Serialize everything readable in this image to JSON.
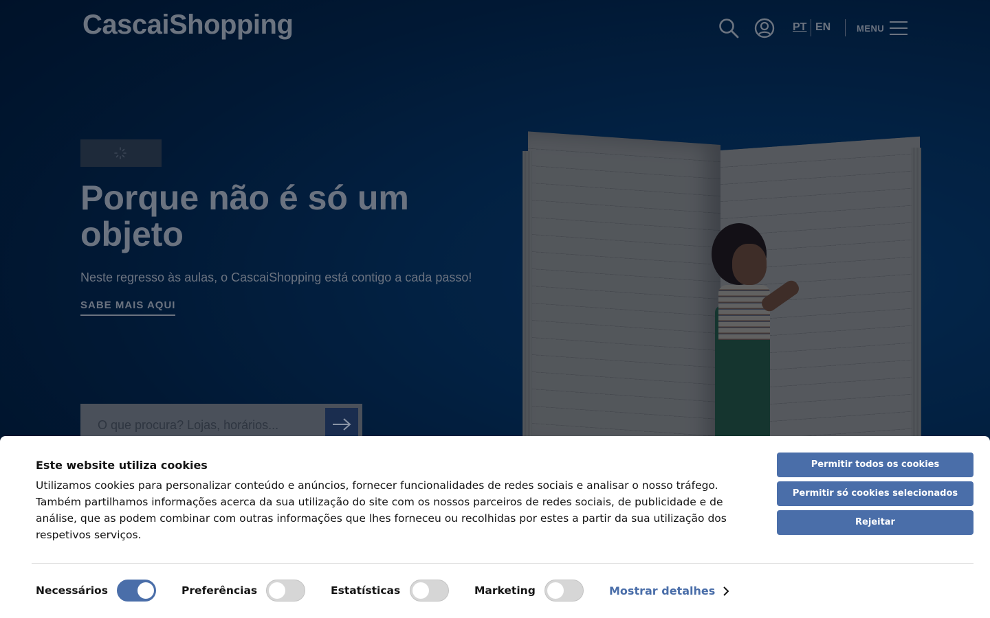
{
  "header": {
    "logo": "CascaiShopping",
    "search_icon": "search-icon",
    "account_icon": "user-circle-icon",
    "lang_pt": "PT",
    "lang_en": "EN",
    "menu_label": "MENU",
    "menu_icon": "hamburger-icon"
  },
  "hero": {
    "title": "Porque não é só um objeto",
    "subtitle": "Neste regresso às aulas, o CascaiShopping está contigo a cada passo!",
    "cta": "SABE MAIS AQUI",
    "search_placeholder": "O que procura? Lojas, horários...",
    "search_button_icon": "arrow-right-icon"
  },
  "cookie_banner": {
    "title": "Este website utiliza cookies",
    "body": "Utilizamos cookies para personalizar conteúdo e anúncios, fornecer funcionalidades de redes sociais e analisar o nosso tráfego. Também partilhamos informações acerca da sua utilização do site com os nossos parceiros de redes sociais, de publicidade e de análise, que as podem combinar com outras informações que lhes forneceu ou recolhidas por estes a partir da sua utilização dos respetivos serviços.",
    "buttons": {
      "allow_all": "Permitir todos os cookies",
      "allow_selected": "Permitir só cookies selecionados",
      "reject": "Rejeitar"
    },
    "toggles": [
      {
        "label": "Necessários",
        "on": true
      },
      {
        "label": "Preferências",
        "on": false
      },
      {
        "label": "Estatísticas",
        "on": false
      },
      {
        "label": "Marketing",
        "on": false
      }
    ],
    "details_link": "Mostrar detalhes"
  },
  "colors": {
    "accent": "#4a6ea9",
    "hero_bg": "#032a52"
  }
}
